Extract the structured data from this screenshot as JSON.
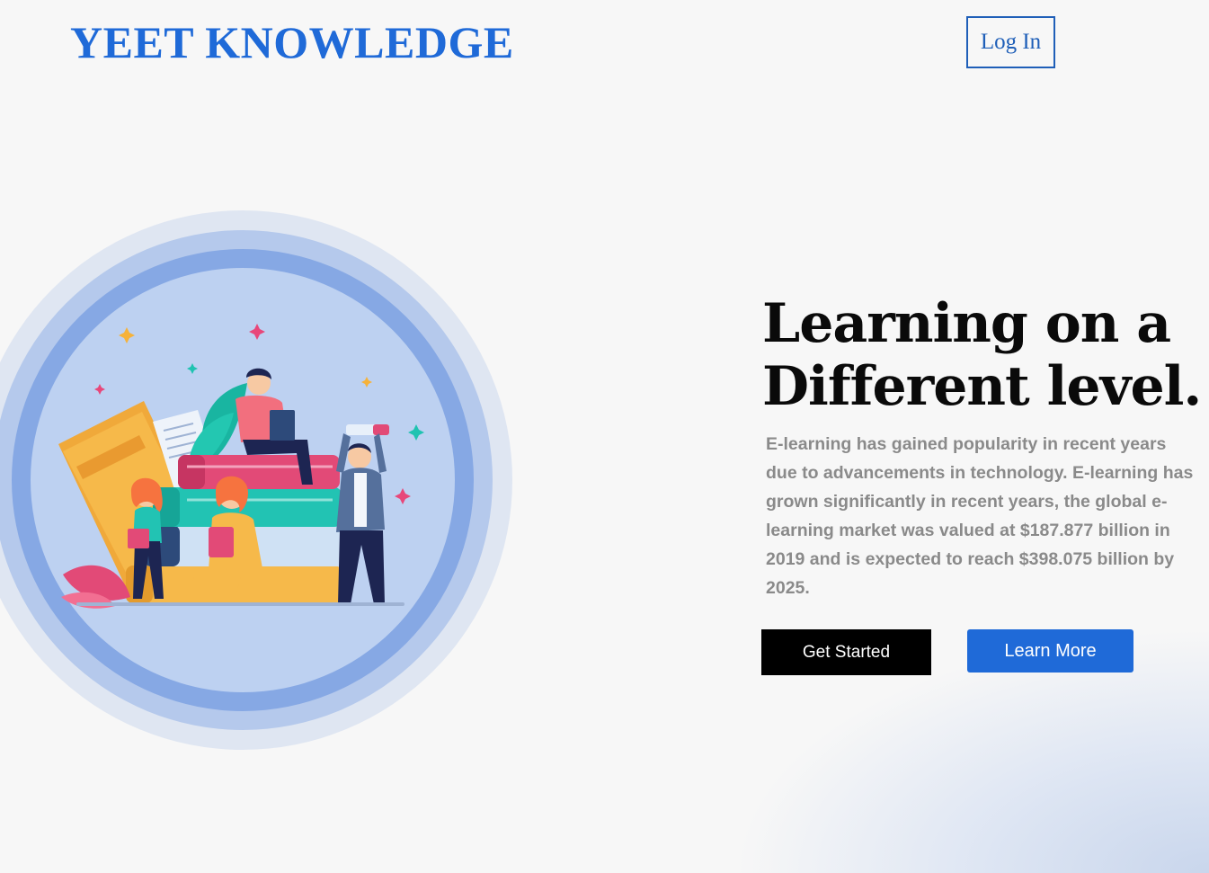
{
  "header": {
    "brand": "YEET KNOWLEDGE",
    "login_label": "Log In"
  },
  "hero": {
    "headline": "Learning on a Different level.",
    "description": "E-learning has gained popularity in recent years due to advancements in technology. E-learning has grown significantly in recent years, the global e-learning market was valued at $187.877 billion in 2019 and is expected to reach $398.075 billion by 2025.",
    "primary_cta": "Get Started",
    "secondary_cta": "Learn More"
  },
  "colors": {
    "brand_blue": "#1f6ad8",
    "background": "#f7f7f7",
    "text_dark": "#0a0a0a",
    "text_muted": "#8a8a8a"
  }
}
